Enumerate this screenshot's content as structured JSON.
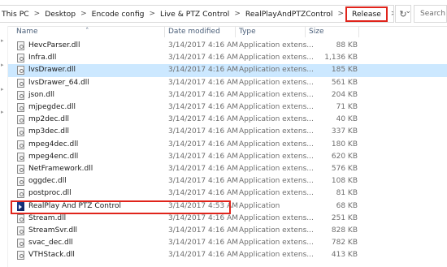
{
  "breadcrumb": {
    "items": [
      "This PC",
      "Desktop",
      "Encode config",
      "Live & PTZ Control",
      "RealPlayAndPTZControl",
      "Release"
    ]
  },
  "search": {
    "placeholder": "Search"
  },
  "columns": {
    "name": "Name",
    "date": "Date modified",
    "type": "Type",
    "size": "Size"
  },
  "files": [
    {
      "name": "HevcParser.dll",
      "date": "3/14/2017 4:16 AM",
      "type": "Application extens...",
      "size": "88 KB",
      "icon": "dll-file-icon"
    },
    {
      "name": "Infra.dll",
      "date": "3/14/2017 4:16 AM",
      "type": "Application extens...",
      "size": "1,136 KB",
      "icon": "dll-file-icon"
    },
    {
      "name": "lvsDrawer.dll",
      "date": "3/14/2017 4:16 AM",
      "type": "Application extens...",
      "size": "185 KB",
      "icon": "dll-file-icon",
      "selected": true
    },
    {
      "name": "lvsDrawer_64.dll",
      "date": "3/14/2017 4:16 AM",
      "type": "Application extens...",
      "size": "561 KB",
      "icon": "dll-file-icon"
    },
    {
      "name": "json.dll",
      "date": "3/14/2017 4:16 AM",
      "type": "Application extens...",
      "size": "204 KB",
      "icon": "dll-file-icon"
    },
    {
      "name": "mjpegdec.dll",
      "date": "3/14/2017 4:16 AM",
      "type": "Application extens...",
      "size": "71 KB",
      "icon": "dll-file-icon"
    },
    {
      "name": "mp2dec.dll",
      "date": "3/14/2017 4:16 AM",
      "type": "Application extens...",
      "size": "40 KB",
      "icon": "dll-file-icon"
    },
    {
      "name": "mp3dec.dll",
      "date": "3/14/2017 4:16 AM",
      "type": "Application extens...",
      "size": "337 KB",
      "icon": "dll-file-icon"
    },
    {
      "name": "mpeg4dec.dll",
      "date": "3/14/2017 4:16 AM",
      "type": "Application extens...",
      "size": "180 KB",
      "icon": "dll-file-icon"
    },
    {
      "name": "mpeg4enc.dll",
      "date": "3/14/2017 4:16 AM",
      "type": "Application extens...",
      "size": "620 KB",
      "icon": "dll-file-icon"
    },
    {
      "name": "NetFramework.dll",
      "date": "3/14/2017 4:16 AM",
      "type": "Application extens...",
      "size": "576 KB",
      "icon": "dll-file-icon"
    },
    {
      "name": "oggdec.dll",
      "date": "3/14/2017 4:16 AM",
      "type": "Application extens...",
      "size": "108 KB",
      "icon": "dll-file-icon"
    },
    {
      "name": "postproc.dll",
      "date": "3/14/2017 4:16 AM",
      "type": "Application extens...",
      "size": "81 KB",
      "icon": "dll-file-icon"
    },
    {
      "name": "RealPlay And PTZ Control",
      "date": "3/14/2017 4:53 AM",
      "type": "Application",
      "size": "68 KB",
      "icon": "application-icon"
    },
    {
      "name": "Stream.dll",
      "date": "3/14/2017 4:16 AM",
      "type": "Application extens...",
      "size": "251 KB",
      "icon": "dll-file-icon"
    },
    {
      "name": "StreamSvr.dll",
      "date": "3/14/2017 4:16 AM",
      "type": "Application extens...",
      "size": "828 KB",
      "icon": "dll-file-icon"
    },
    {
      "name": "svac_dec.dll",
      "date": "3/14/2017 4:16 AM",
      "type": "Application extens...",
      "size": "782 KB",
      "icon": "dll-file-icon"
    },
    {
      "name": "VTHStack.dll",
      "date": "3/14/2017 4:16 AM",
      "type": "Application extens...",
      "size": "413 KB",
      "icon": "dll-file-icon"
    }
  ],
  "colors": {
    "highlight": "#e0241b",
    "selection": "#cce8ff",
    "header_text": "#4c607a"
  }
}
